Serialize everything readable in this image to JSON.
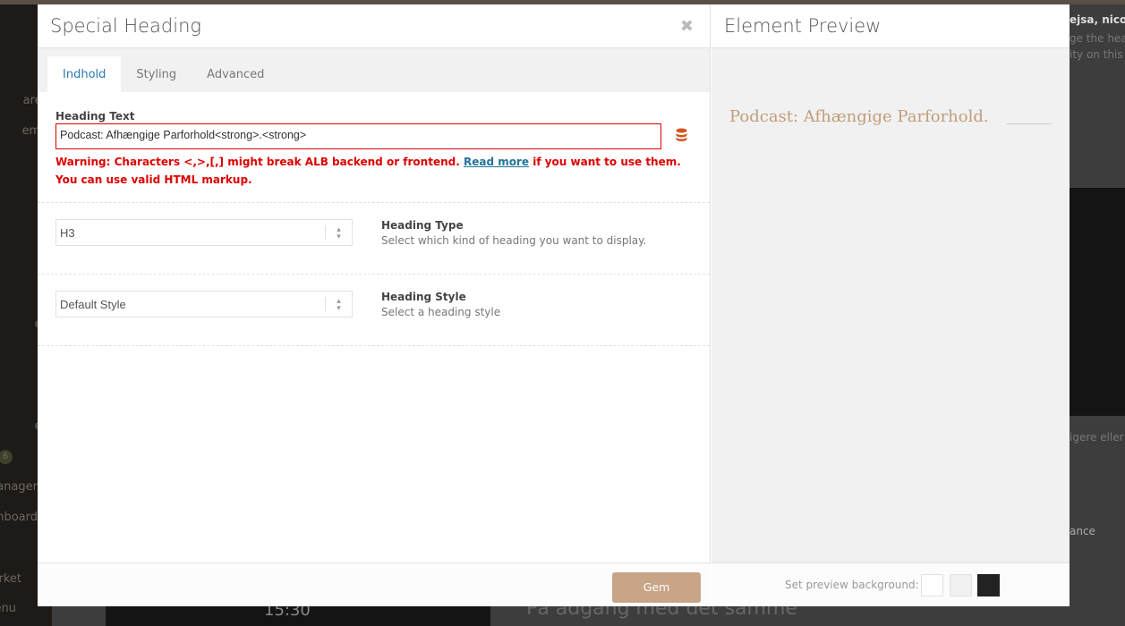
{
  "background": {
    "sidebar_items": [
      "arer",
      "ems",
      "er",
      "er",
      "anager",
      "hboard",
      "rket",
      "enu"
    ],
    "badges": [
      "6"
    ],
    "right_texts": [
      "ejsa, nicolea",
      "ge the hea",
      "ity on this",
      "igere eller",
      "ance"
    ],
    "bottom_texts": [
      "15:30",
      "På adgang med det samme"
    ]
  },
  "modal": {
    "title": "Special Heading",
    "close_icon": "close-icon",
    "tabs": [
      {
        "label": "Indhold",
        "active": true
      },
      {
        "label": "Styling"
      },
      {
        "label": "Advanced"
      }
    ],
    "heading_text": {
      "label": "Heading Text",
      "value": "Podcast: Afhængige Parforhold<strong>.<strong>",
      "warning_pre": "Warning: Characters <,>,[,] might break ALB backend or frontend.",
      "warning_link": "Read more",
      "warning_post": "if you want to use them. You can use valid HTML markup."
    },
    "heading_type": {
      "value": "H3",
      "label": "Heading Type",
      "desc": "Select which kind of heading you want to display."
    },
    "heading_style": {
      "value": "Default Style",
      "label": "Heading Style",
      "desc": "Select a heading style"
    },
    "save_label": "Gem",
    "accent": "#c8a586"
  },
  "preview": {
    "title": "Element Preview",
    "heading": "Podcast: Afhængige Parforhold.",
    "bg_label": "Set preview background:",
    "swatches": [
      "#ffffff",
      "#f1f1f1",
      "#222222"
    ]
  }
}
